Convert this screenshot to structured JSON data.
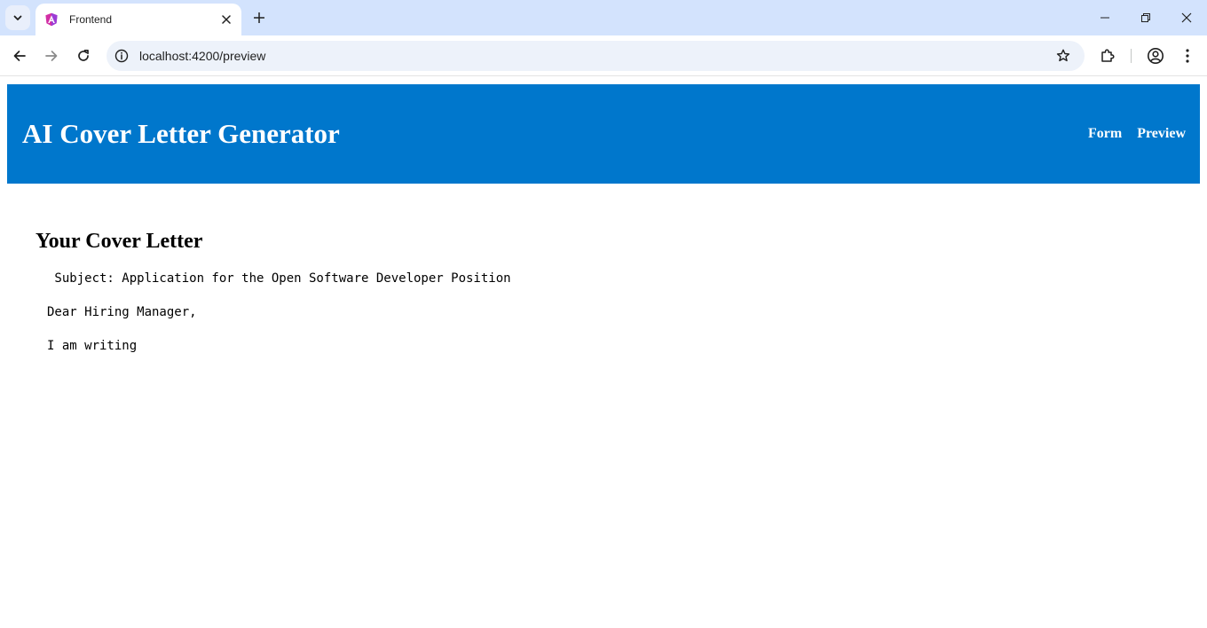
{
  "browser": {
    "tab": {
      "title": "Frontend",
      "favicon": "angular-icon"
    },
    "url": "localhost:4200/preview"
  },
  "app": {
    "title": "AI Cover Letter Generator",
    "nav": [
      {
        "label": "Form"
      },
      {
        "label": "Preview"
      }
    ]
  },
  "preview": {
    "heading": "Your Cover Letter",
    "lines": [
      " Subject: Application for the Open Software Developer Position",
      "Dear Hiring Manager,",
      "I am writing"
    ]
  },
  "colors": {
    "header_bg": "#0077cc",
    "tabstrip_bg": "#d3e3fd",
    "omnibox_bg": "#edf2fa"
  }
}
